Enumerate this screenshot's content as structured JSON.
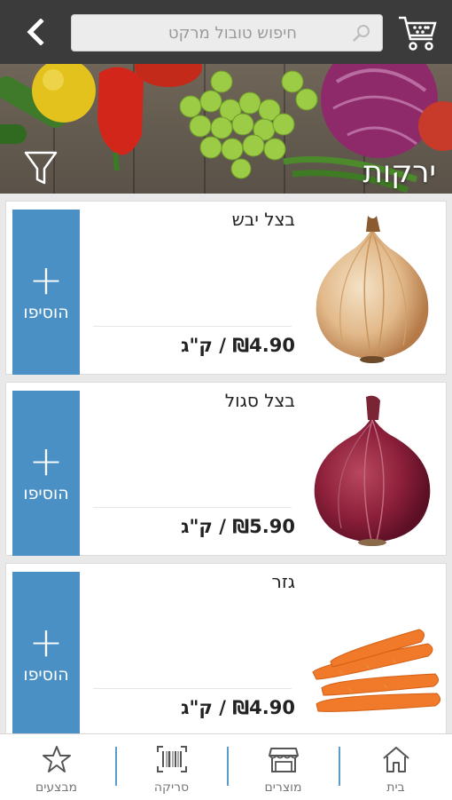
{
  "header": {
    "search_placeholder": "חיפוש טובול מרקט"
  },
  "banner": {
    "category_title": "ירקות"
  },
  "products": [
    {
      "name": "בצל יבש",
      "price": "₪4.90 / ק\"ג",
      "add_label": "הוסיפו",
      "add_symbol": "+"
    },
    {
      "name": "בצל סגול",
      "price": "₪5.90 / ק\"ג",
      "add_label": "הוסיפו",
      "add_symbol": "+"
    },
    {
      "name": "גזר",
      "price": "₪4.90 / ק\"ג",
      "add_label": "הוסיפו",
      "add_symbol": "+"
    }
  ],
  "bottom_nav": [
    {
      "label": "מבצעים",
      "icon": "star-icon"
    },
    {
      "label": "סריקה",
      "icon": "barcode-icon"
    },
    {
      "label": "מוצרים",
      "icon": "store-icon"
    },
    {
      "label": "בית",
      "icon": "home-icon"
    }
  ],
  "colors": {
    "topbar": "#3b3b3b",
    "accent": "#4a90c4",
    "nav_separator": "#5a9bc9"
  }
}
